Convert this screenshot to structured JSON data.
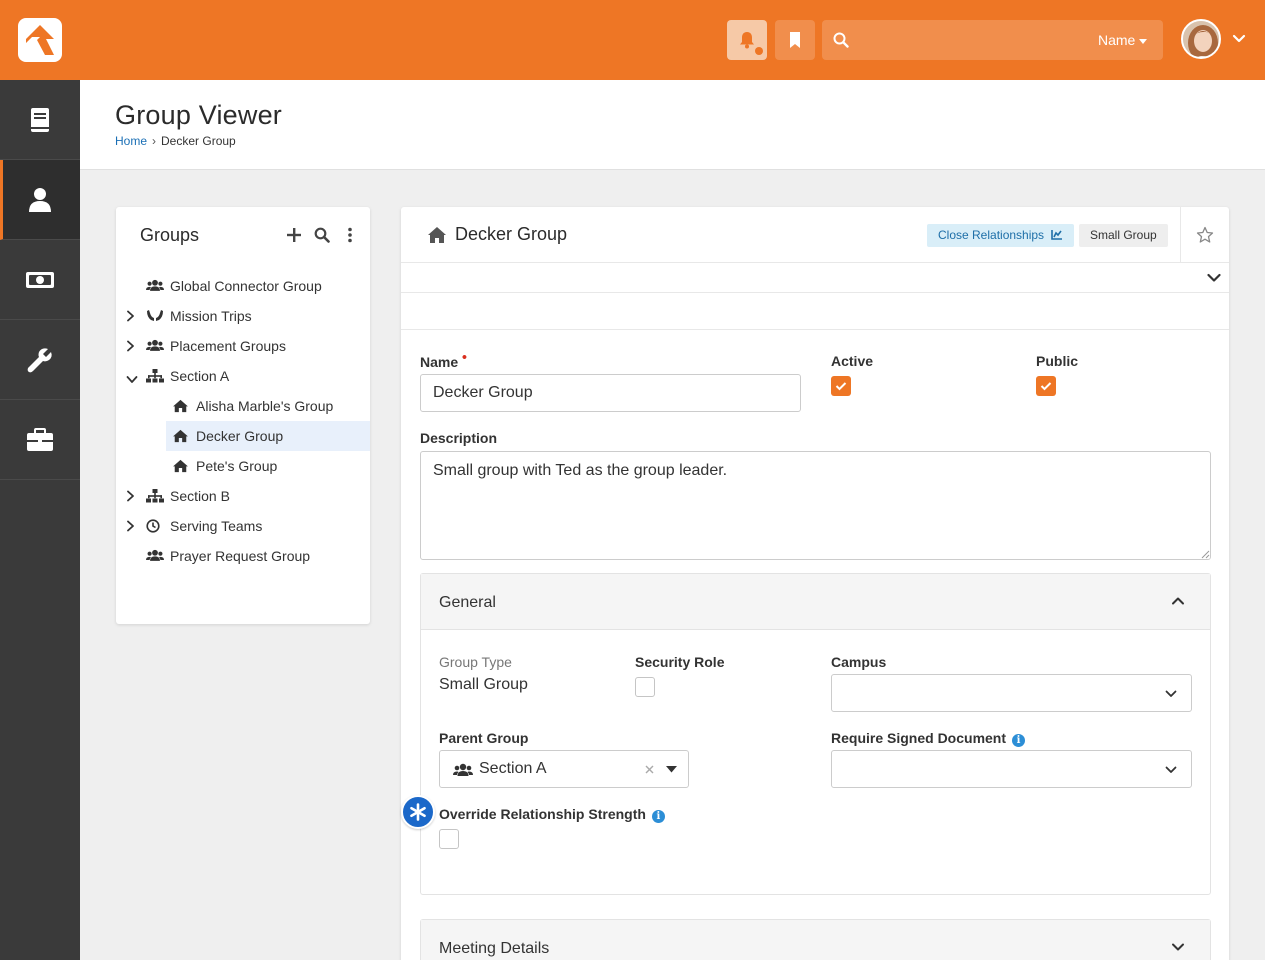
{
  "topbar": {
    "search_placeholder": "",
    "search_scope": "Name"
  },
  "page": {
    "title": "Group Viewer",
    "breadcrumb": [
      "Home",
      "Decker Group"
    ]
  },
  "groups_panel": {
    "title": "Groups",
    "tree": [
      {
        "label": "Global Connector Group",
        "icon": "users-icon",
        "expandable": false,
        "expanded": false,
        "level": 0,
        "selected": false
      },
      {
        "label": "Mission Trips",
        "icon": "hands-icon",
        "expandable": true,
        "expanded": false,
        "level": 0,
        "selected": false
      },
      {
        "label": "Placement Groups",
        "icon": "users-icon",
        "expandable": true,
        "expanded": false,
        "level": 0,
        "selected": false
      },
      {
        "label": "Section A",
        "icon": "sitemap-icon",
        "expandable": true,
        "expanded": true,
        "level": 0,
        "selected": false
      },
      {
        "label": "Alisha Marble's Group",
        "icon": "home-icon",
        "expandable": false,
        "expanded": false,
        "level": 1,
        "selected": false
      },
      {
        "label": "Decker Group",
        "icon": "home-icon",
        "expandable": false,
        "expanded": false,
        "level": 1,
        "selected": true
      },
      {
        "label": "Pete's Group",
        "icon": "home-icon",
        "expandable": false,
        "expanded": false,
        "level": 1,
        "selected": false
      },
      {
        "label": "Section B",
        "icon": "sitemap-icon",
        "expandable": true,
        "expanded": false,
        "level": 0,
        "selected": false
      },
      {
        "label": "Serving Teams",
        "icon": "clock-icon",
        "expandable": true,
        "expanded": false,
        "level": 0,
        "selected": false
      },
      {
        "label": "Prayer Request Group",
        "icon": "users-icon",
        "expandable": false,
        "expanded": false,
        "level": 0,
        "selected": false
      }
    ]
  },
  "main_panel": {
    "title": "Decker Group",
    "badges": {
      "close_relationships": "Close Relationships",
      "small_group": "Small Group"
    },
    "form": {
      "name_label": "Name",
      "name_value": "Decker Group",
      "active_label": "Active",
      "active_checked": true,
      "public_label": "Public",
      "public_checked": true,
      "description_label": "Description",
      "description_value": "Small group with Ted as the group leader."
    },
    "general": {
      "title": "General",
      "group_type_label": "Group Type",
      "group_type_value": "Small Group",
      "security_role_label": "Security Role",
      "security_role_checked": false,
      "campus_label": "Campus",
      "campus_value": "",
      "parent_group_label": "Parent Group",
      "parent_group_value": "Section A",
      "require_signed_label": "Require Signed Document",
      "require_signed_value": "",
      "override_label": "Override Relationship Strength",
      "override_checked": false
    },
    "meeting_details": {
      "title": "Meeting Details"
    }
  },
  "colors": {
    "brand": "#ee7625",
    "sidebar": "#3a3a3a",
    "link": "#1a6fb5",
    "callout": "#1b68c9"
  }
}
